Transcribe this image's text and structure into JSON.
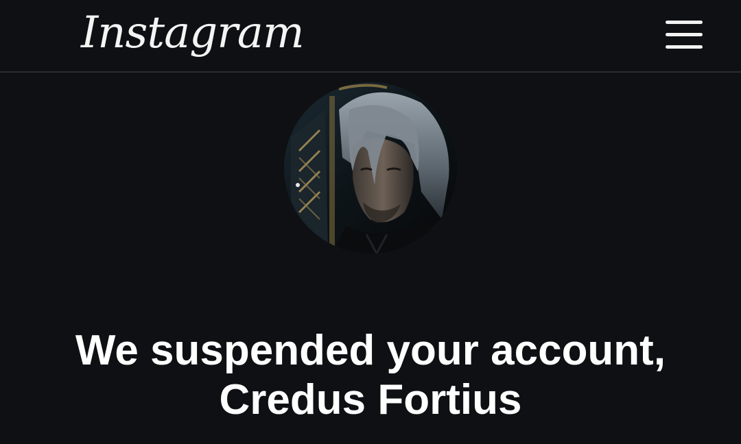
{
  "header": {
    "logo_text": "Instagram",
    "menu_icon": "hamburger-menu-icon"
  },
  "profile": {
    "avatar_icon": "profile-avatar"
  },
  "message": {
    "line1": "We suspended your account,",
    "line2": "Credus Fortius"
  },
  "colors": {
    "background": "#0f1013",
    "text": "#ffffff",
    "divider": "#2c2d31"
  }
}
